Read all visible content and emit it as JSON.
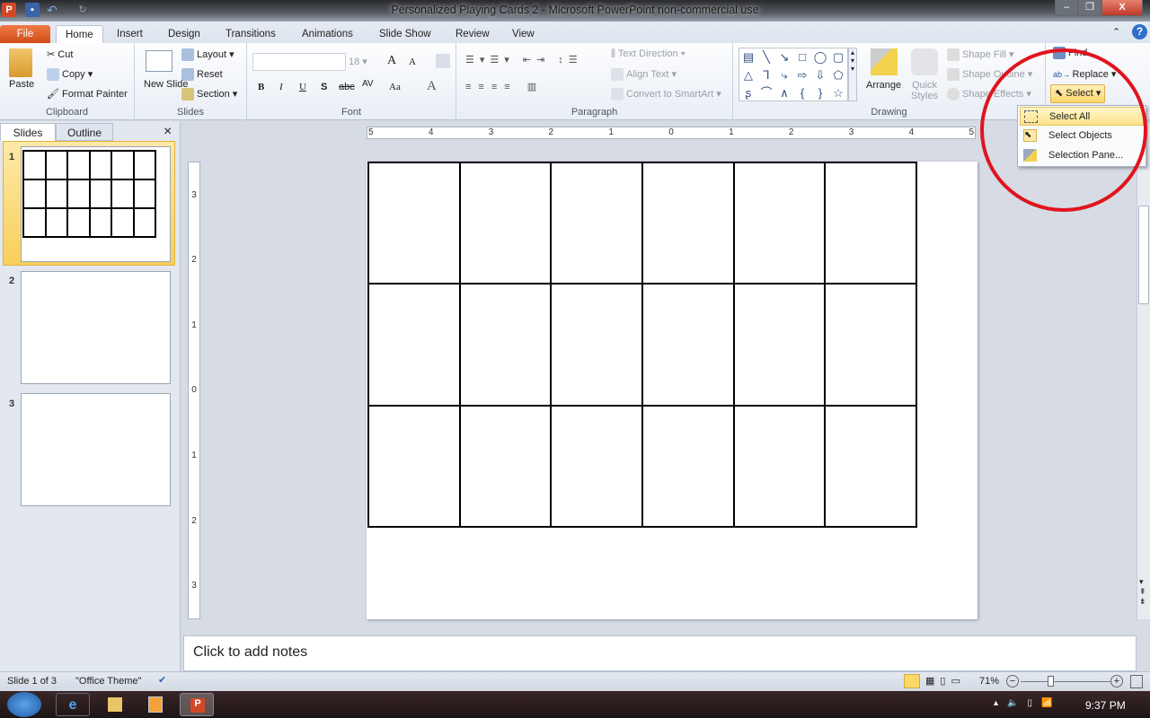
{
  "window": {
    "title": "Personalized Playing Cards 2  -  Microsoft PowerPoint non-commercial use",
    "app_icon": "P",
    "minimize": "–",
    "restore": "❐",
    "close": "X"
  },
  "tabs": [
    "File",
    "Home",
    "Insert",
    "Design",
    "Transitions",
    "Animations",
    "Slide Show",
    "Review",
    "View"
  ],
  "ribbon": {
    "clipboard": {
      "label": "Clipboard",
      "paste": "Paste",
      "cut": "Cut",
      "copy": "Copy",
      "format_painter": "Format Painter"
    },
    "slides": {
      "label": "Slides",
      "new_slide": "New Slide",
      "layout": "Layout",
      "reset": "Reset",
      "section": "Section"
    },
    "font": {
      "label": "Font",
      "font_name": "",
      "font_size": "18",
      "bold": "B",
      "italic": "I",
      "underline": "U",
      "shadow": "S",
      "strike": "abc",
      "spacing": "AV",
      "case": "Aa",
      "color": "A",
      "grow": "A",
      "shrink": "A"
    },
    "paragraph": {
      "label": "Paragraph",
      "text_direction": "Text Direction",
      "align_text": "Align Text",
      "convert_smartart": "Convert to SmartArt"
    },
    "drawing": {
      "label": "Drawing",
      "arrange": "Arrange",
      "quick_styles": "Quick Styles",
      "shape_fill": "Shape Fill",
      "shape_outline": "Shape Outline",
      "shape_effects": "Shape Effects",
      "shapes": [
        "▤",
        "╲",
        "↘",
        "□",
        "◯",
        "▢",
        "△",
        "⅂",
        "⤷",
        "⇨",
        "⇩",
        "⬠",
        "ʂ",
        "⌒",
        "∧",
        "{",
        "}",
        "☆"
      ]
    },
    "editing": {
      "find": "Find",
      "replace": "Replace",
      "select": "Select"
    }
  },
  "select_menu": {
    "items": [
      "Select All",
      "Select Objects",
      "Selection Pane..."
    ],
    "highlighted": "Select All"
  },
  "left_pane": {
    "tabs": [
      "Slides",
      "Outline"
    ],
    "close": "×",
    "slides": [
      "1",
      "2",
      "3"
    ],
    "selected": "1"
  },
  "rulers": {
    "horizontal": [
      "5",
      "4",
      "3",
      "2",
      "1",
      "0",
      "1",
      "2",
      "3",
      "4",
      "5"
    ],
    "vertical": [
      "3",
      "2",
      "1",
      "0",
      "1",
      "2",
      "3"
    ]
  },
  "notes": {
    "placeholder": "Click to add notes"
  },
  "status": {
    "slide": "Slide 1 of 3",
    "theme": "\"Office Theme\"",
    "zoom": "71%"
  },
  "taskbar": {
    "time": "9:37 PM"
  },
  "colors": {
    "file_tab": "#e05a22",
    "highlight": "#fde38b",
    "annotation_circle": "#e0141e"
  }
}
